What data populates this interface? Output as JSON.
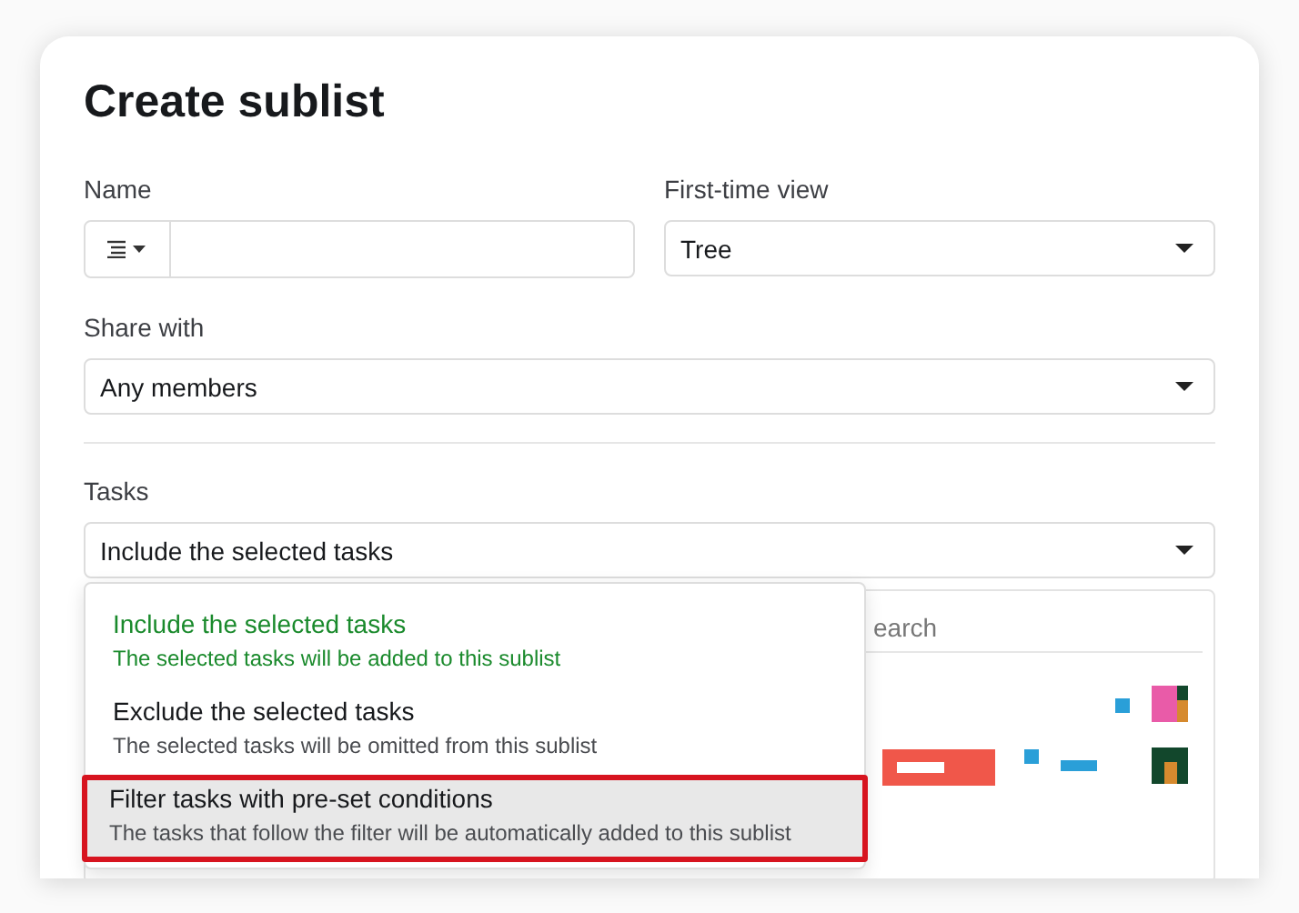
{
  "dialog": {
    "title": "Create sublist"
  },
  "name_field": {
    "label": "Name"
  },
  "first_time_view": {
    "label": "First-time view",
    "value": "Tree"
  },
  "share_with": {
    "label": "Share with",
    "value": "Any members"
  },
  "tasks": {
    "label": "Tasks",
    "value": "Include the selected tasks",
    "expanded": true
  },
  "task_options": [
    {
      "title": "Include the selected tasks",
      "description": "The selected tasks will be added to this sublist",
      "selected": true,
      "highlighted": false
    },
    {
      "title": "Exclude the selected tasks",
      "description": "The selected tasks will be omitted from this sublist",
      "selected": false,
      "highlighted": false
    },
    {
      "title": "Filter tasks with pre-set conditions",
      "description": "The tasks that follow the filter will be automatically added to this sublist",
      "selected": false,
      "highlighted": true
    }
  ],
  "task_panel": {
    "search_placeholder": "earch"
  }
}
